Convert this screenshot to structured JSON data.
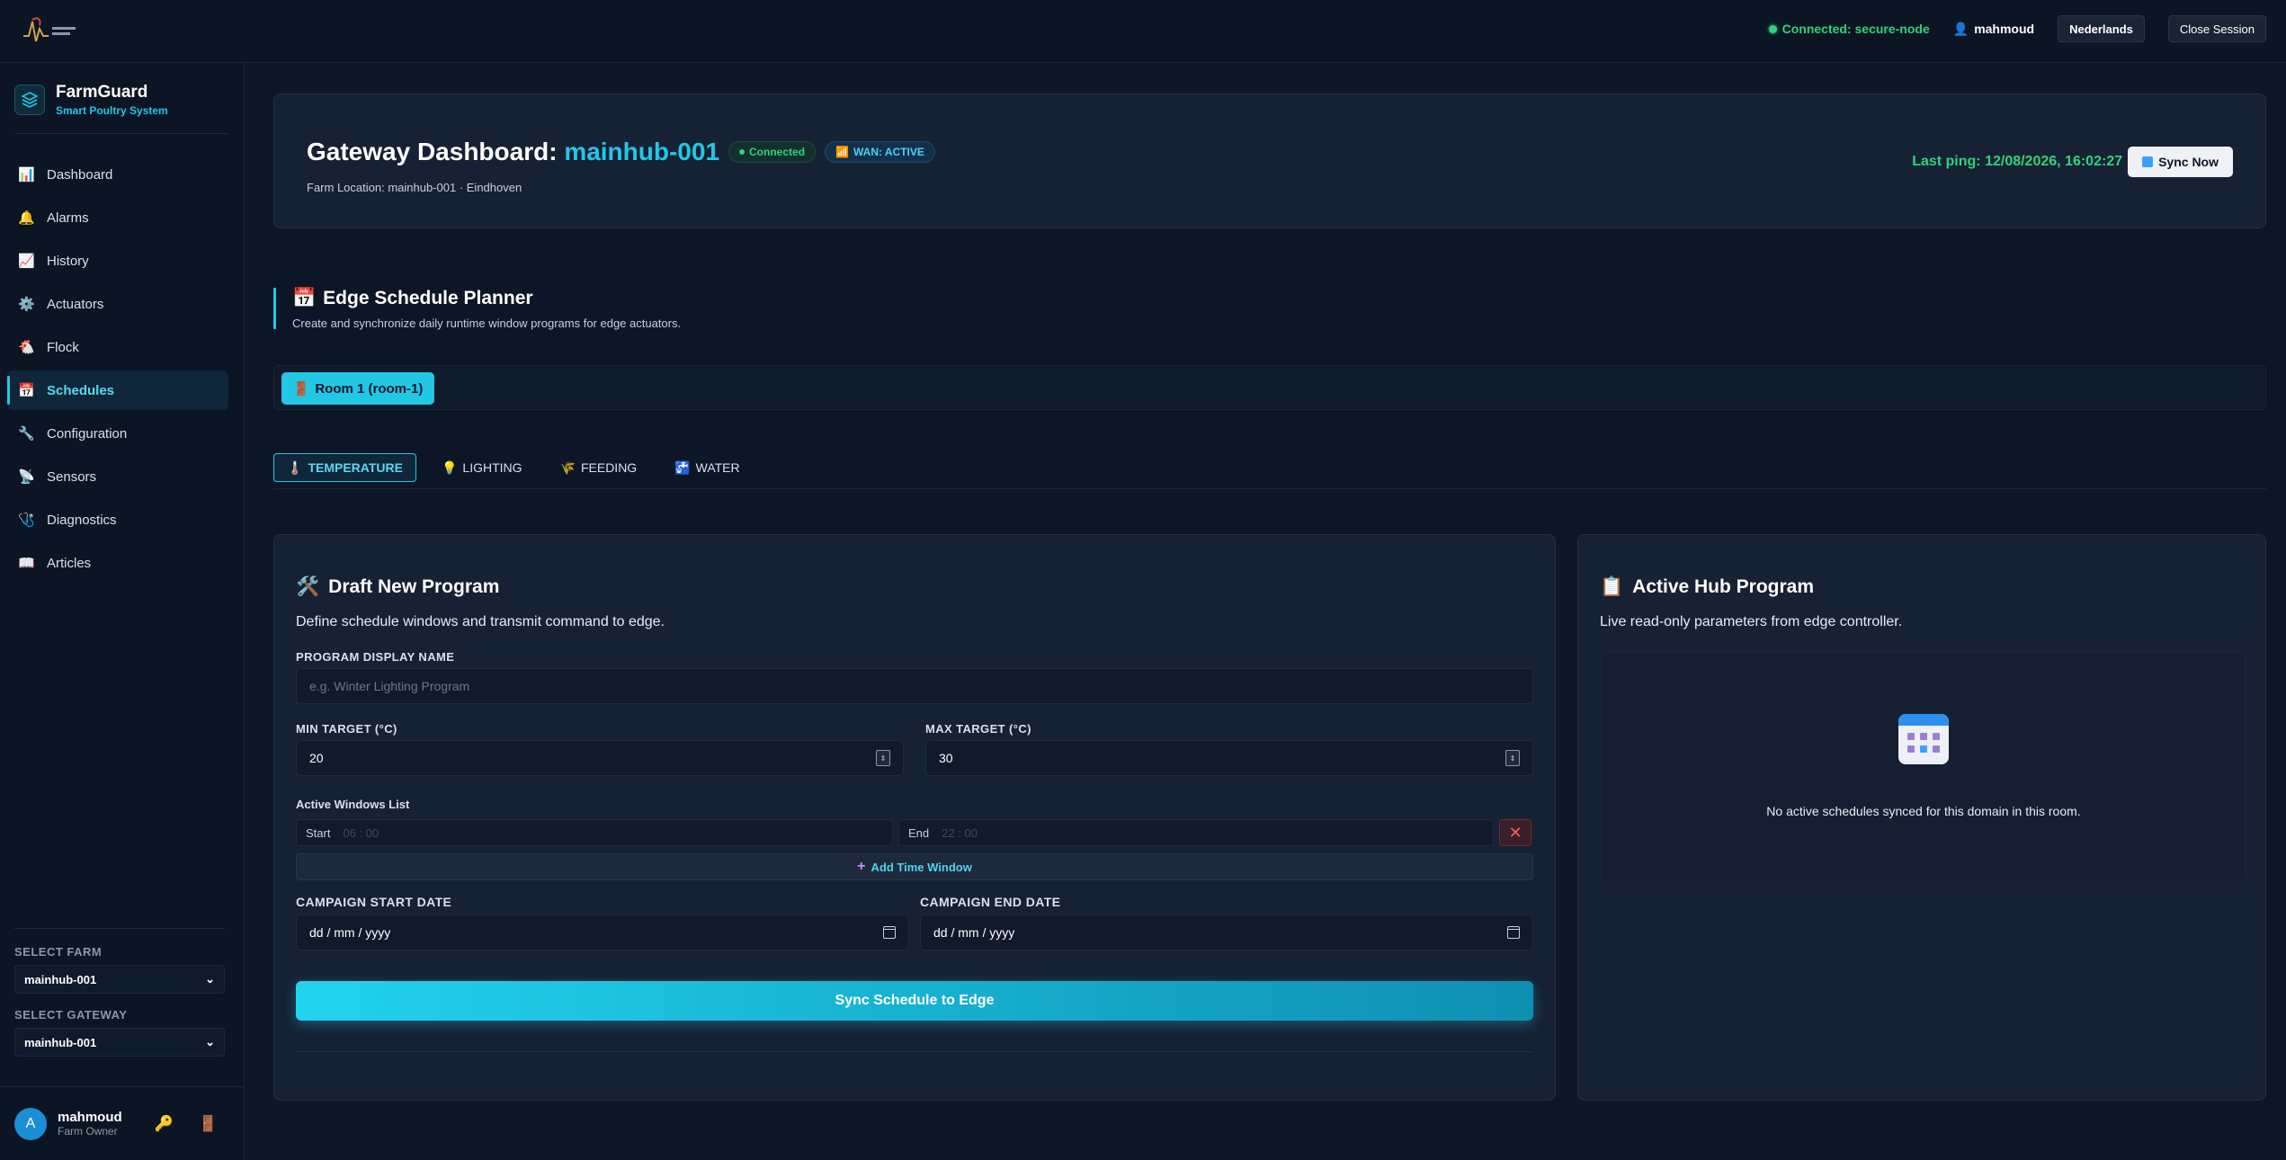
{
  "topbar": {
    "connection": "Connected: secure-node",
    "user": "mahmoud",
    "language_btn": "Nederlands",
    "close_btn": "Close Session"
  },
  "sidebar": {
    "brand_name": "FarmGuard",
    "brand_sub": "Smart Poultry System",
    "items": [
      {
        "label": "Dashboard",
        "icon": "📊"
      },
      {
        "label": "Alarms",
        "icon": "🔔"
      },
      {
        "label": "History",
        "icon": "📈"
      },
      {
        "label": "Actuators",
        "icon": "⚙️"
      },
      {
        "label": "Flock",
        "icon": "🐔"
      },
      {
        "label": "Schedules",
        "icon": "📅"
      },
      {
        "label": "Configuration",
        "icon": "🔧"
      },
      {
        "label": "Sensors",
        "icon": "📡"
      },
      {
        "label": "Diagnostics",
        "icon": "🩺"
      },
      {
        "label": "Articles",
        "icon": "📖"
      }
    ],
    "active_index": 5,
    "farm_label": "SELECT FARM",
    "farm_value": "mainhub-001",
    "gateway_label": "SELECT GATEWAY",
    "gateway_value": "mainhub-001",
    "user_initial": "A",
    "user_name": "mahmoud",
    "user_role": "Farm Owner"
  },
  "gateway": {
    "title_prefix": "Gateway Dashboard:",
    "hub": "mainhub-001",
    "status_pill": "Connected",
    "wan_pill": "WAN: ACTIVE",
    "location": "Farm Location: mainhub-001 · Eindhoven",
    "last_ping": "Last ping: 12/08/2026, 16:02:27",
    "sync_btn": "Sync Now"
  },
  "planner": {
    "title": "Edge Schedule Planner",
    "subtitle": "Create and synchronize daily runtime window programs for edge actuators.",
    "room_btn": "Room 1 (room-1)",
    "tabs": [
      {
        "label": "TEMPERATURE",
        "icon": "🌡️"
      },
      {
        "label": "LIGHTING",
        "icon": "💡"
      },
      {
        "label": "FEEDING",
        "icon": "🌾"
      },
      {
        "label": "WATER",
        "icon": "🚰"
      }
    ]
  },
  "draft": {
    "title": "Draft New Program",
    "desc": "Define schedule windows and transmit command to edge.",
    "name_label": "PROGRAM DISPLAY NAME",
    "name_placeholder": "e.g. Winter Lighting Program",
    "min_label": "MIN TARGET (°C)",
    "min_value": "20",
    "max_label": "MAX TARGET (°C)",
    "max_value": "30",
    "windows_label": "Active Windows List",
    "start_label": "Start",
    "start_time": "06 : 00",
    "end_label": "End",
    "end_time": "22 : 00",
    "add_window": "Add Time Window",
    "start_date_label": "CAMPAIGN START DATE",
    "end_date_label": "CAMPAIGN END DATE",
    "date_placeholder": "dd / mm / yyyy",
    "sync_btn": "Sync Schedule to Edge"
  },
  "hub_program": {
    "title": "Active Hub Program",
    "desc": "Live read-only parameters from edge controller.",
    "empty": "No active schedules synced for this domain in this room."
  }
}
